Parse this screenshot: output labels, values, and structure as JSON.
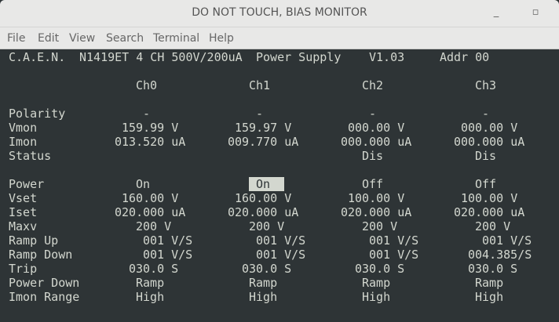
{
  "window": {
    "title": "DO NOT TOUCH, BIAS MONITOR",
    "minimize": "_",
    "maximize": "▫"
  },
  "menu": [
    "File",
    "Edit",
    "View",
    "Search",
    "Terminal",
    "Help"
  ],
  "terminal": {
    "header": {
      "brand": "C.A.E.N.",
      "model": "N1419ET 4 CH 500V/200uA",
      "product": "Power Supply",
      "version": "V1.03",
      "address": "Addr 00"
    },
    "channels": [
      "Ch0",
      "Ch1",
      "Ch2",
      "Ch3"
    ],
    "rows": [
      {
        "label": "Polarity",
        "values": [
          "-",
          "-",
          "-",
          "-"
        ]
      },
      {
        "label": "Vmon",
        "values": [
          "159.99 V",
          "159.97 V",
          "000.00 V",
          "000.00 V"
        ]
      },
      {
        "label": "Imon",
        "values": [
          "013.520 uA",
          "009.770 uA",
          "000.000 uA",
          "000.000 uA"
        ]
      },
      {
        "label": "Status",
        "values": [
          "",
          "",
          "Dis",
          "Dis"
        ]
      },
      {
        "label": "Power",
        "values": [
          "On",
          "On",
          "Off",
          "Off"
        ]
      },
      {
        "label": "Vset",
        "values": [
          "160.00 V",
          "160.00 V",
          "100.00 V",
          "100.00 V"
        ]
      },
      {
        "label": "Iset",
        "values": [
          "020.000 uA",
          "020.000 uA",
          "020.000 uA",
          "020.000 uA"
        ]
      },
      {
        "label": "Maxv",
        "values": [
          "200 V",
          "200 V",
          "200 V",
          "200 V"
        ]
      },
      {
        "label": "Ramp Up",
        "values": [
          "001 V/S",
          "001 V/S",
          "001 V/S",
          "001 V/S"
        ]
      },
      {
        "label": "Ramp Down",
        "values": [
          "001 V/S",
          "001 V/S",
          "001 V/S",
          "004.385/S"
        ]
      },
      {
        "label": "Trip",
        "values": [
          "030.0 S",
          "030.0 S",
          "030.0 S",
          "030.0 S"
        ]
      },
      {
        "label": "Power Down",
        "values": [
          "Ramp",
          "Ramp",
          "Ramp",
          "Ramp"
        ]
      },
      {
        "label": "Imon Range",
        "values": [
          "High",
          "High",
          "High",
          "High"
        ]
      }
    ],
    "cursor": {
      "row": "Power",
      "channel": "Ch1"
    }
  }
}
